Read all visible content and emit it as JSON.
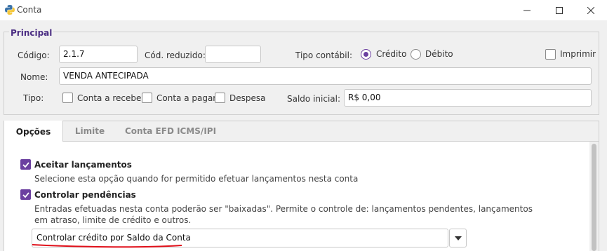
{
  "window": {
    "title": "Conta",
    "icon": "python-icon",
    "controls": [
      "minimize-icon",
      "maximize-icon",
      "close-icon"
    ]
  },
  "principal": {
    "group_title": "Principal",
    "codigo_label": "Código:",
    "codigo_value": "2.1.7",
    "cod_reduzido_label": "Cód. reduzido:",
    "cod_reduzido_value": "",
    "tipo_contabil_label": "Tipo contábil:",
    "tipo_contabil_options": [
      {
        "label": "Crédito",
        "selected": true
      },
      {
        "label": "Débito",
        "selected": false
      }
    ],
    "imprimir_label": "Imprimir",
    "imprimir_checked": false,
    "nome_label": "Nome:",
    "nome_value": "VENDA ANTECIPADA",
    "tipo_label": "Tipo:",
    "tipo_options": [
      {
        "label": "Conta a receber",
        "checked": false
      },
      {
        "label": "Conta a pagar",
        "checked": false
      },
      {
        "label": "Despesa",
        "checked": false
      }
    ],
    "saldo_inicial_label": "Saldo inicial:",
    "saldo_inicial_value": "R$ 0,00"
  },
  "tabs": [
    {
      "label": "Opções",
      "active": true
    },
    {
      "label": "Limite",
      "active": false
    },
    {
      "label": "Conta EFD ICMS/IPI",
      "active": false
    }
  ],
  "opcoes": {
    "aceitar": {
      "label": "Aceitar lançamentos",
      "checked": true,
      "description": "Selecione esta opção quando for permitido efetuar lançamentos nesta conta"
    },
    "controlar": {
      "label": "Controlar pendências",
      "checked": true,
      "description": "Entradas efetuadas nesta conta poderão ser \"baixadas\". Permite o controle de: lançamentos pendentes, lançamentos em atraso, limite de crédito e outros."
    },
    "modo_controle_value": "Controlar crédito por Saldo da Conta"
  },
  "colors": {
    "accent": "#6b3fa0",
    "annotation": "#e0101a"
  }
}
